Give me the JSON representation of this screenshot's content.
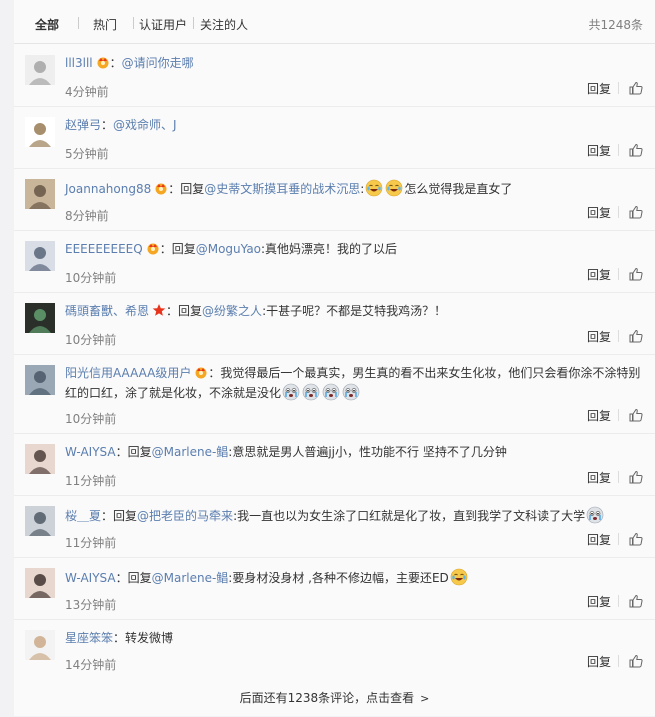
{
  "tabs": [
    {
      "label": "全部",
      "active": true
    },
    {
      "label": "热门"
    },
    {
      "label": "认证用户"
    },
    {
      "label": "关注的人"
    }
  ],
  "total": "共1248条",
  "reply_label": "回复",
  "more_text": "后面还有1238条评论，点击查看",
  "comments": [
    {
      "user": "lll3lll",
      "colon": "：",
      "parts": [
        {
          "m": "@请问你走哪"
        }
      ],
      "time": "4分钟前"
    },
    {
      "user": "赵弹弓",
      "colon": "：",
      "parts": [
        {
          "m": "@戏命师、J"
        }
      ],
      "time": "5分钟前"
    },
    {
      "user": "Joannahong88",
      "colon": "：",
      "parts": [
        {
          "t": "回复"
        },
        {
          "m": "@史蒂文斯摸耳垂的战术沉思"
        },
        {
          "t": ":"
        },
        {
          "e": "laugh"
        },
        {
          "e": "laugh"
        },
        {
          "t": "怎么觉得我是直女了"
        }
      ],
      "time": "8分钟前"
    },
    {
      "user": "EEEEEEEEEQ",
      "colon": "：",
      "parts": [
        {
          "t": "回复"
        },
        {
          "m": "@MoguYao"
        },
        {
          "t": ":真他妈漂亮！我的了以后"
        }
      ],
      "time": "10分钟前"
    },
    {
      "user": "碼頭畜獸、希恩",
      "colon": "：",
      "parts": [
        {
          "t": "回复"
        },
        {
          "m": "@纷繁之人"
        },
        {
          "t": ":干甚子呢？不都是艾特我鸡汤？！"
        }
      ],
      "time": "10分钟前"
    },
    {
      "user": "阳光信用AAAAA级用户",
      "colon": "：",
      "parts": [
        {
          "t": "我觉得最后一个最真实，男生真的看不出来女生化妆，他们只会看你涂不涂特别红的口红，涂了就是化妆，不涂就是没化"
        },
        {
          "e": "cry"
        },
        {
          "e": "cry"
        },
        {
          "e": "cry"
        },
        {
          "e": "cry"
        }
      ],
      "time": "10分钟前"
    },
    {
      "user": "W-AIYSA",
      "colon": "：",
      "parts": [
        {
          "t": "回复"
        },
        {
          "m": "@Marlene-鲳"
        },
        {
          "t": ":意思就是男人普遍jj小，性功能不行 坚持不了几分钟"
        }
      ],
      "time": "11分钟前"
    },
    {
      "user": "桜＿夏",
      "colon": "：",
      "parts": [
        {
          "t": "回复"
        },
        {
          "m": "@把老臣的马牵来"
        },
        {
          "t": ":我一直也以为女生涂了口红就是化了妆，直到我学了文科读了大学"
        },
        {
          "e": "cry"
        }
      ],
      "time": "11分钟前"
    },
    {
      "user": "W-AIYSA",
      "colon": "：",
      "parts": [
        {
          "t": "回复"
        },
        {
          "m": "@Marlene-鲳"
        },
        {
          "t": ":要身材没身材 ,各种不修边幅，主要还ED"
        },
        {
          "e": "laugh"
        }
      ],
      "time": "13分钟前"
    },
    {
      "user": "星座笨笨",
      "colon": "：",
      "parts": [
        {
          "t": "转发微博"
        }
      ],
      "time": "14分钟前"
    }
  ]
}
